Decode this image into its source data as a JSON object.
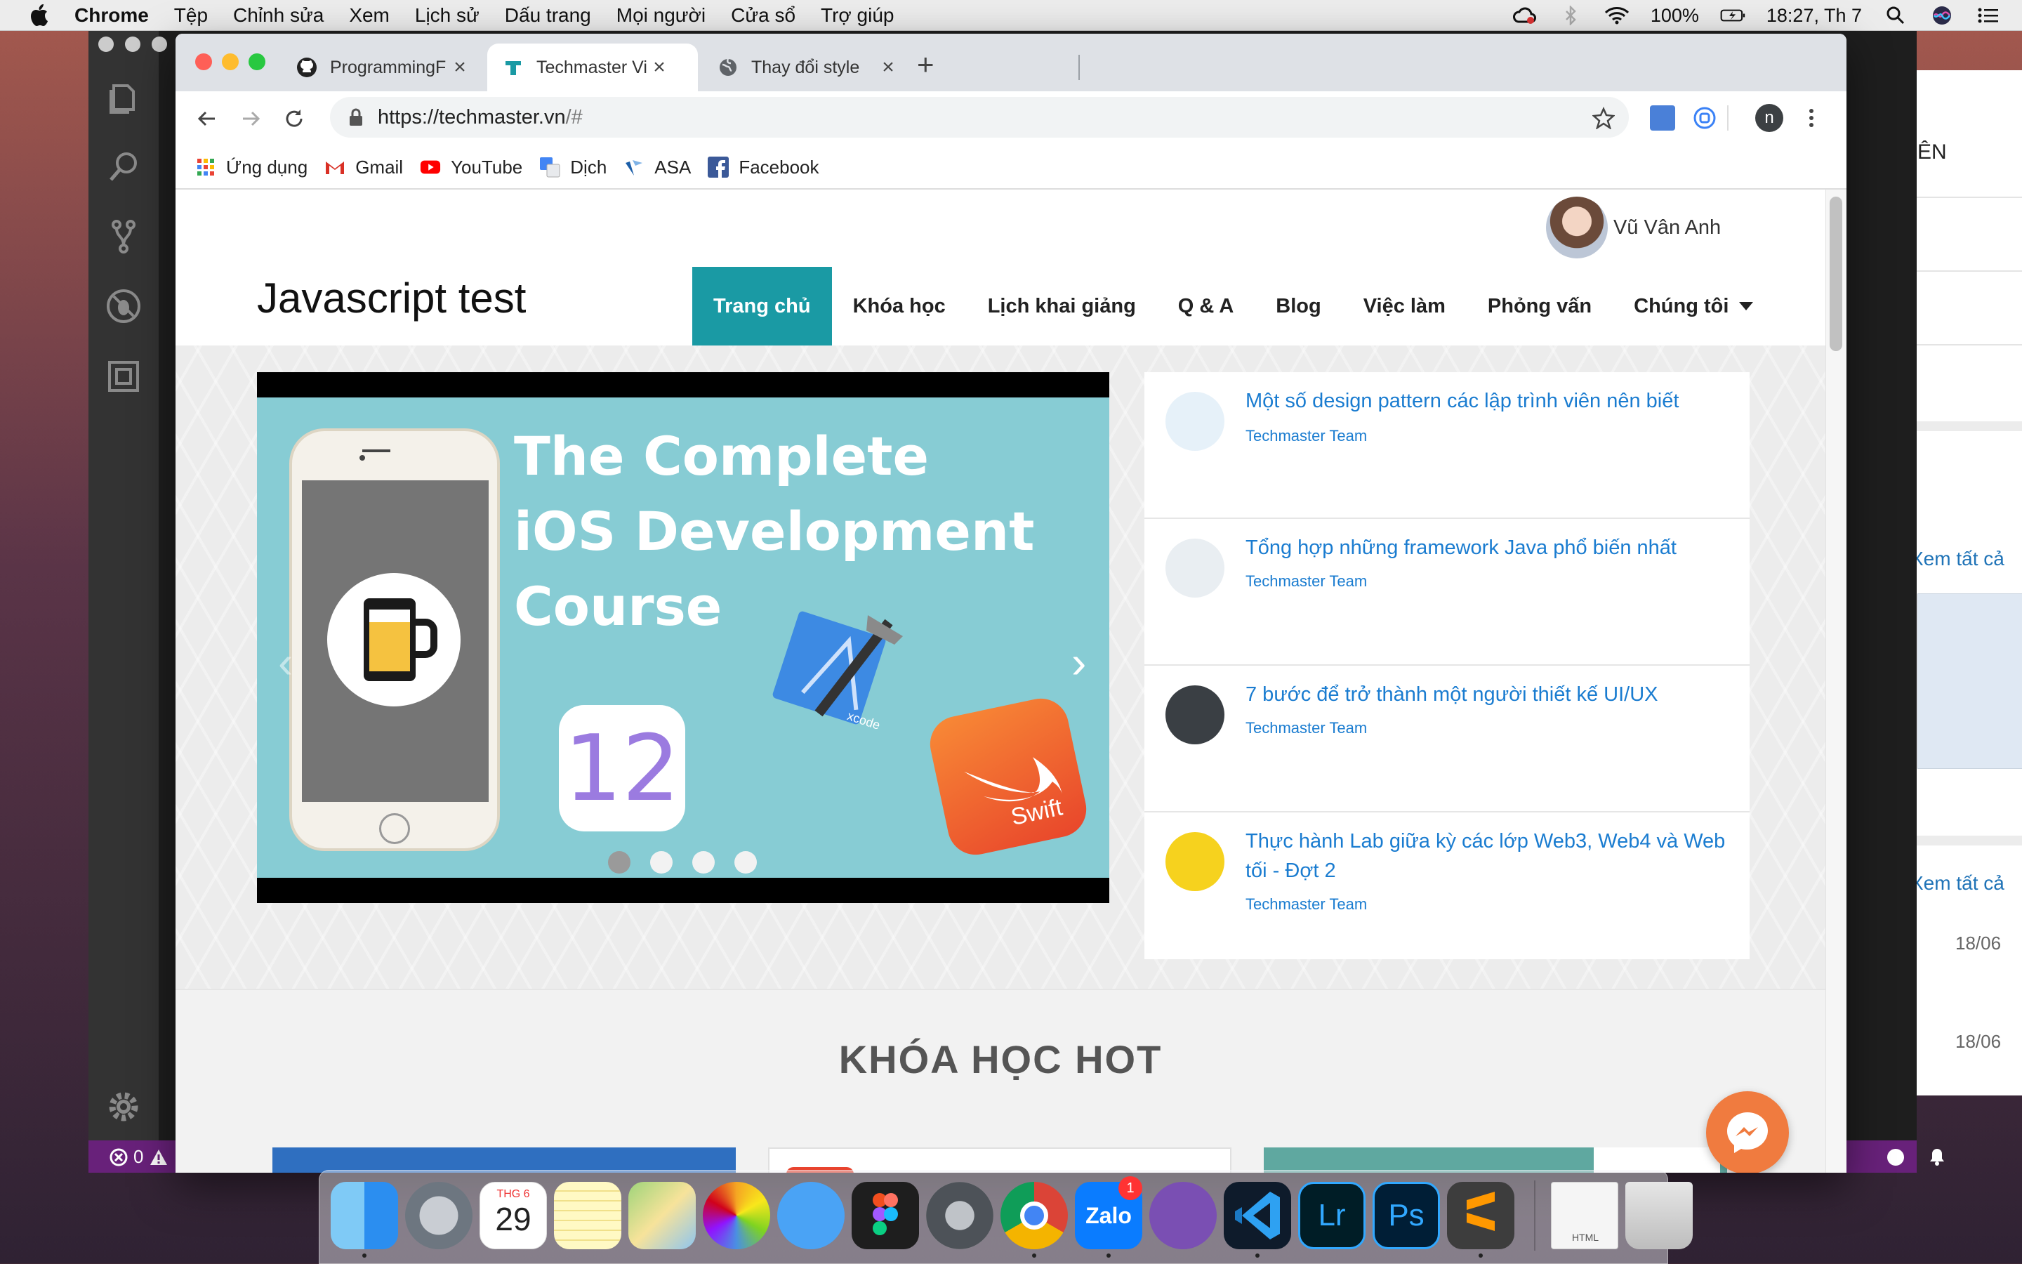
{
  "menubar": {
    "app": "Chrome",
    "items": [
      "Tệp",
      "Chỉnh sửa",
      "Xem",
      "Lịch sử",
      "Dấu trang",
      "Mọi người",
      "Cửa sổ",
      "Trợ giúp"
    ],
    "battery": "100%",
    "clock": "18:27, Th 7"
  },
  "background_window": {
    "heading": "ÊN",
    "link1": "Xem tất cả",
    "link2": "Xem tất cả",
    "date1": "18/06",
    "date2": "18/06"
  },
  "vscode": {
    "status_errors": "0"
  },
  "browser": {
    "tabs": [
      {
        "title": "ProgrammingF",
        "icon": "github-icon"
      },
      {
        "title": "Techmaster Vi",
        "icon": "techmaster-icon"
      },
      {
        "title": "Thay đổi style",
        "icon": "globe-icon"
      }
    ],
    "new_tab": "+",
    "url_host": "https://techmaster.vn",
    "url_path": "/#",
    "profile_initial": "n",
    "bookmarks": [
      {
        "label": "Ứng dụng",
        "icon": "apps-grid-icon"
      },
      {
        "label": "Gmail",
        "icon": "gmail-icon"
      },
      {
        "label": "YouTube",
        "icon": "youtube-icon"
      },
      {
        "label": "Dịch",
        "icon": "translate-icon"
      },
      {
        "label": "ASA",
        "icon": "asa-icon"
      },
      {
        "label": "Facebook",
        "icon": "facebook-icon"
      }
    ]
  },
  "site": {
    "logo": "Javascript test",
    "user_name": "Vũ Vân Anh",
    "nav": [
      "Trang chủ",
      "Khóa học",
      "Lịch khai giảng",
      "Q & A",
      "Blog",
      "Việc làm",
      "Phỏng vấn",
      "Chúng tôi"
    ],
    "nav_active": "Trang chủ",
    "slide": {
      "title_line1": "The Complete",
      "title_line2": "iOS Development",
      "title_line3": "Course",
      "ios_version": "12",
      "swift_label": "Swift",
      "xcode_label": "xcode",
      "prev": "‹",
      "next": "›",
      "dot_count": 4,
      "active_dot": 1
    },
    "articles": [
      {
        "title": "Một số design pattern các lập trình viên nên biết",
        "author": "Techmaster Team"
      },
      {
        "title": "Tổng hợp những framework Java phổ biến nhất",
        "author": "Techmaster Team"
      },
      {
        "title": "7 bước để trở thành một người thiết kế UI/UX",
        "author": "Techmaster Team"
      },
      {
        "title": "Thực hành Lab giữa kỳ các lớp Web3, Web4 và Web tối - Đợt 2",
        "author": "Techmaster Team"
      }
    ],
    "hot_title": "KHÓA HỌC HOT"
  },
  "dock": {
    "calendar_month": "THG 6",
    "calendar_day": "29",
    "zalo_label": "Zalo",
    "zalo_badge": "1",
    "lr_label": "Lr",
    "ps_label": "Ps",
    "html_label": "HTML"
  },
  "colors": {
    "nav_active": "#1a9aa4",
    "link": "#1a7cd0",
    "vscode_status": "#68217a",
    "messenger": "#f07b3f",
    "slide_bg": "#87ccd4"
  }
}
